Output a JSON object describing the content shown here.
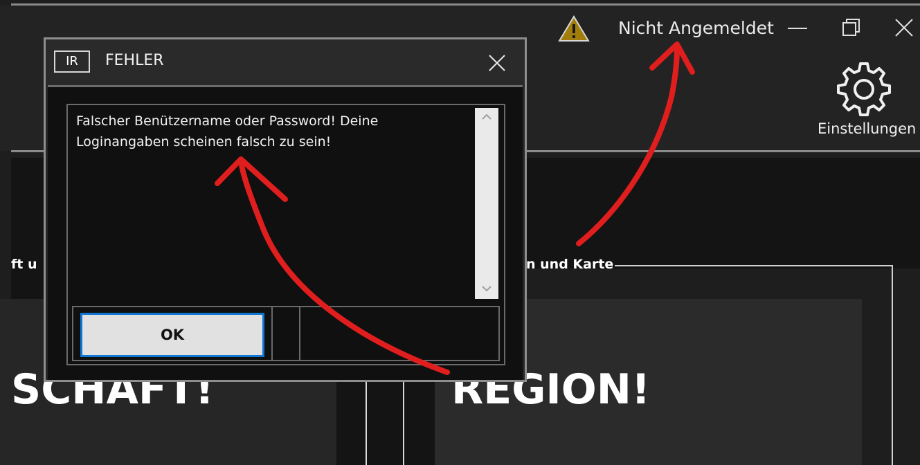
{
  "app": {
    "status": "Nicht Angemeldet",
    "settings_label": "Einstellungen",
    "group_left_label": "ft u",
    "group_right_label": "n und Karte",
    "big_left_text": "SCHAFT!",
    "big_right_text": "REGION!"
  },
  "dialog": {
    "logo_text": "IR",
    "title": "FEHLER",
    "message": "Falscher Benützername oder Password!  Deine Loginangaben scheinen falsch zu sein!",
    "ok_label": "OK"
  },
  "colors": {
    "annotation": "#e01e1e",
    "focus_border": "#1177d4",
    "warning": "#b8860b"
  },
  "icons": [
    "warning-icon",
    "minimize-icon",
    "restore-icon",
    "close-icon",
    "gear-icon",
    "dialog-close-icon",
    "scroll-up-icon",
    "scroll-down-icon"
  ]
}
